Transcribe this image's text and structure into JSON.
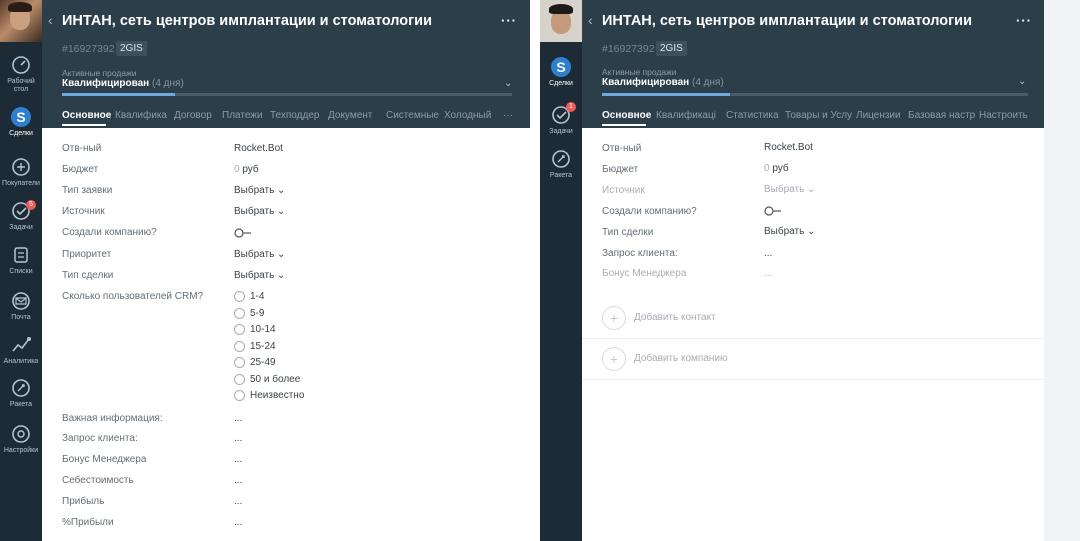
{
  "left": {
    "nav": [
      {
        "key": "desk",
        "label1": "Рабочий",
        "label2": "стол"
      },
      {
        "key": "deals",
        "label1": "Сделки",
        "label2": ""
      },
      {
        "key": "buyers",
        "label1": "Покупатели",
        "label2": ""
      },
      {
        "key": "tasks",
        "label1": "Задачи",
        "label2": "",
        "badge": "5"
      },
      {
        "key": "lists",
        "label1": "Списки",
        "label2": ""
      },
      {
        "key": "mail",
        "label1": "Почта",
        "label2": ""
      },
      {
        "key": "analytics",
        "label1": "Аналитика",
        "label2": ""
      },
      {
        "key": "rocket",
        "label1": "Ракета",
        "label2": ""
      },
      {
        "key": "settings",
        "label1": "Настройки",
        "label2": ""
      }
    ],
    "header": {
      "title": "ИНТАН, сеть центров имплантации и стоматологии",
      "deal_id": "#16927392",
      "tag": "2GIS",
      "pipeline": "Активные продажи",
      "stage": "Квалифицирован",
      "duration": "(4 дня)",
      "more": "···",
      "back": "‹",
      "progress": 0.25
    },
    "tabs": [
      "Основное",
      "Квалифика",
      "Договор",
      "Платежи",
      "Техподдер",
      "Документ",
      "Системные",
      "Холодный",
      "···"
    ],
    "fields": [
      {
        "label": "Отв-ный",
        "value": "Rocket.Bot"
      },
      {
        "label": "Бюджет",
        "value_zero": "0",
        "value": "руб"
      },
      {
        "label": "Тип заявки",
        "value": "Выбрать ⌄"
      },
      {
        "label": "Источник",
        "value": "Выбрать ⌄"
      },
      {
        "label": "Создали компанию?",
        "value": ""
      },
      {
        "label": "Приоритет",
        "value": "Выбрать ⌄"
      },
      {
        "label": "Тип сделки",
        "value": "Выбрать ⌄"
      },
      {
        "label": "Сколько пользователей CRM?",
        "value": ""
      }
    ],
    "radio_options": [
      "1-4",
      "5-9",
      "10-14",
      "15-24",
      "25-49",
      "50 и более",
      "Неизвестно"
    ],
    "fields2": [
      {
        "label": "Важная информация:",
        "value": "..."
      },
      {
        "label": "Запрос клиента:",
        "value": "..."
      },
      {
        "label": "Бонус Менеджера",
        "value": "..."
      },
      {
        "label": "Себестоимость",
        "value": "..."
      },
      {
        "label": "Прибыль",
        "value": "..."
      },
      {
        "label": "%Прибыли",
        "value": "..."
      }
    ]
  },
  "right": {
    "nav": [
      {
        "key": "deals",
        "label1": "Сделки",
        "label2": ""
      },
      {
        "key": "tasks",
        "label1": "Задачи",
        "label2": "",
        "badge": "1"
      },
      {
        "key": "rocket",
        "label1": "Ракета",
        "label2": ""
      }
    ],
    "header": {
      "title": "ИНТАН, сеть центров имплантации и стоматологии",
      "deal_id": "#16927392",
      "tag": "2GIS",
      "pipeline": "Активные продажи",
      "stage": "Квалифицирован",
      "duration": "(4 дня)",
      "more": "···",
      "back": "‹",
      "progress": 0.3
    },
    "tabs": [
      "Основное",
      "Квалификаці",
      "Статистика",
      "Товары и Услу",
      "Лицензии",
      "Базовая настр",
      "Настроить"
    ],
    "fields": [
      {
        "label": "Отв-ный",
        "value": "Rocket.Bot"
      },
      {
        "label": "Бюджет",
        "value_zero": "0",
        "value": "руб"
      },
      {
        "label": "Источник",
        "value": "Выбрать ⌄",
        "muted": true
      },
      {
        "label": "Создали компанию?",
        "value": ""
      },
      {
        "label": "Тип сделки",
        "value": "Выбрать ⌄"
      },
      {
        "label": "Запрос клиента:",
        "value": "..."
      },
      {
        "label": "Бонус Менеджера",
        "value": "...",
        "muted": true
      }
    ],
    "add_contact": "Добавить контакт",
    "add_company": "Добавить компанию"
  },
  "colors": {
    "sidebar": "#1d2b36",
    "header": "#2c3e4a",
    "accent": "#6ea7e0",
    "badge": "#f25a5a"
  }
}
